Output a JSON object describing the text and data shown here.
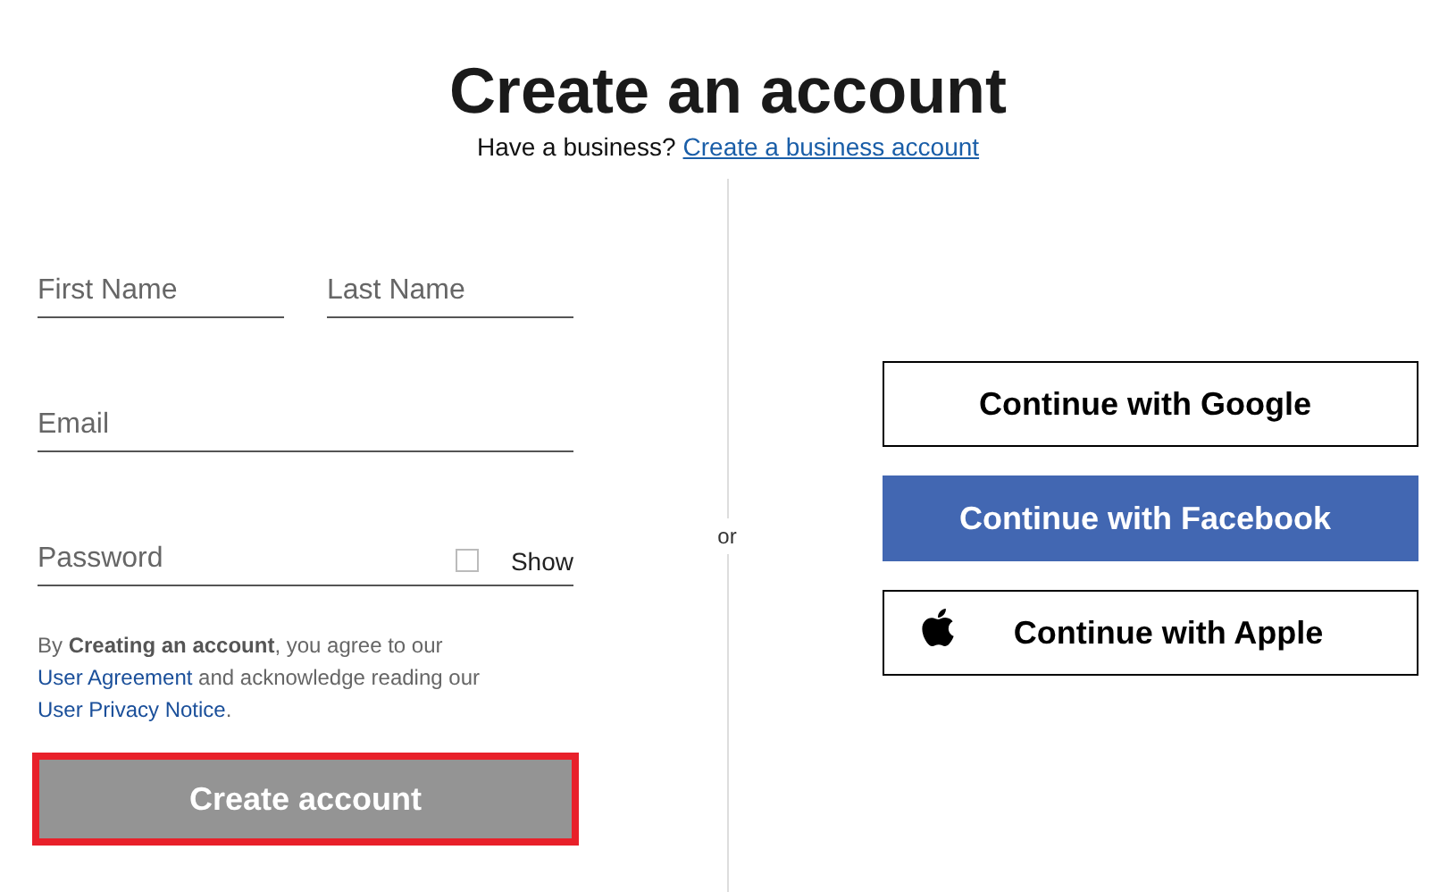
{
  "header": {
    "title": "Create an account",
    "subtitle": "Have a business?",
    "subtitle_link": "Create a business account"
  },
  "form": {
    "name_fields": [
      {
        "placeholder": "First Name"
      },
      {
        "placeholder": "Last Name"
      }
    ],
    "email": {
      "placeholder": "Email"
    },
    "password": {
      "placeholder": "Password",
      "show_label": "Show",
      "show_checked": false
    },
    "legal": [
      {
        "kind": "text",
        "text": "By **Creating an account**, you agree to our "
      },
      {
        "kind": "link",
        "text": "User Agreement"
      },
      {
        "kind": "text",
        "text": " and acknowledge reading our "
      },
      {
        "kind": "link",
        "text": "User Privacy Notice"
      },
      {
        "kind": "text",
        "text": "."
      }
    ],
    "submit": {
      "label": "Create account",
      "disabled": true,
      "highlighted": true
    }
  },
  "divider_label": "or",
  "social_buttons": [
    {
      "kind": "google",
      "label": "Continue with Google"
    },
    {
      "kind": "facebook",
      "label": "Continue with Facebook"
    },
    {
      "kind": "apple",
      "label": "Continue with Apple"
    }
  ]
}
